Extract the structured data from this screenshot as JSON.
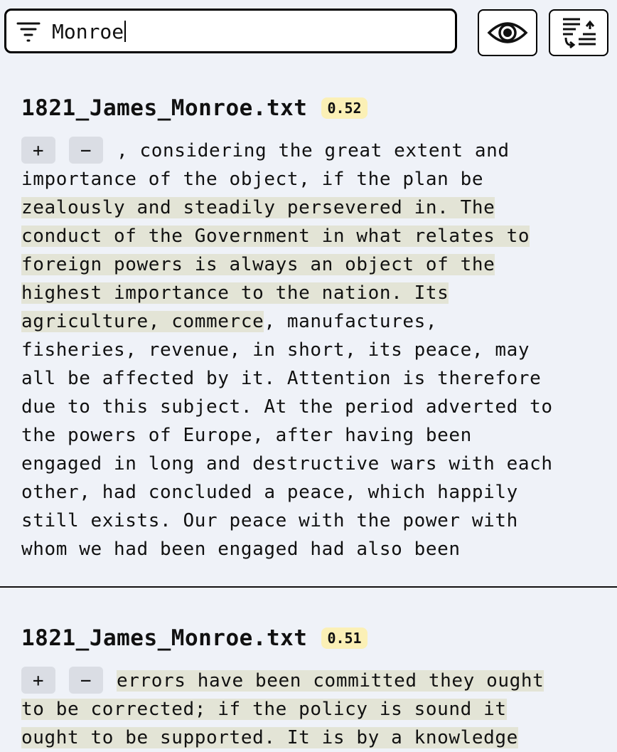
{
  "search": {
    "value": "Monroe"
  },
  "results": [
    {
      "filename": "1821_James_Monroe.txt",
      "score": "0.52",
      "expand_label": "+",
      "collapse_label": "−",
      "lines": [
        [
          {
            "t": ", considering the great extent and",
            "h": false
          }
        ],
        [
          {
            "t": "importance of the object, if the plan be",
            "h": false
          }
        ],
        [
          {
            "t": "zealously and steadily persevered in. The",
            "h": true
          }
        ],
        [
          {
            "t": "conduct of the Government in what relates to",
            "h": true
          }
        ],
        [
          {
            "t": "foreign powers is always an object of the",
            "h": true
          }
        ],
        [
          {
            "t": "highest importance to the nation. Its",
            "h": true
          }
        ],
        [
          {
            "t": "agriculture, commerce",
            "h": true
          },
          {
            "t": ", manufactures,",
            "h": false
          }
        ],
        [
          {
            "t": "fisheries, revenue, in short, its peace, may",
            "h": false
          }
        ],
        [
          {
            "t": "all be affected by it. Attention is therefore",
            "h": false
          }
        ],
        [
          {
            "t": "due to this subject. At the period adverted to",
            "h": false
          }
        ],
        [
          {
            "t": "the powers of Europe, after having been",
            "h": false
          }
        ],
        [
          {
            "t": "engaged in long and destructive wars with each",
            "h": false
          }
        ],
        [
          {
            "t": "other, had concluded a peace, which happily",
            "h": false
          }
        ],
        [
          {
            "t": "still exists. Our peace with the power with",
            "h": false
          }
        ],
        [
          {
            "t": "whom we had been engaged had also been",
            "h": false
          }
        ]
      ]
    },
    {
      "filename": "1821_James_Monroe.txt",
      "score": "0.51",
      "expand_label": "+",
      "collapse_label": "−",
      "lines": [
        [
          {
            "t": "errors have been committed they ought",
            "h": true
          }
        ],
        [
          {
            "t": "to be corrected; if the policy is sound it",
            "h": true
          }
        ],
        [
          {
            "t": "ought to be supported. It is by a knowledge",
            "h": true
          }
        ]
      ]
    }
  ]
}
